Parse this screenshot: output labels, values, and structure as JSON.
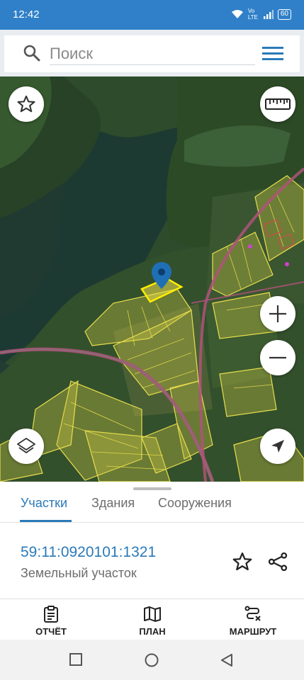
{
  "status_bar": {
    "time": "12:42",
    "network": "Vo LTE",
    "battery": "60"
  },
  "search": {
    "placeholder": "Поиск"
  },
  "map": {
    "controls": [
      "star-icon",
      "ruler-icon",
      "plus-icon",
      "minus-icon",
      "layers-icon",
      "navigation-arrow-icon"
    ],
    "marker": "map-pin-icon"
  },
  "sheet": {
    "tabs": [
      {
        "label": "Участки",
        "active": true
      },
      {
        "label": "Здания",
        "active": false
      },
      {
        "label": "Сооружения",
        "active": false
      }
    ],
    "parcel_number": "59:11:0920101:1321",
    "parcel_type": "Земельный участок"
  },
  "bottom_nav": {
    "items": [
      {
        "label": "ОТЧЁТ",
        "icon": "clipboard-icon"
      },
      {
        "label": "ПЛАН",
        "icon": "map-icon"
      },
      {
        "label": "МАРШРУТ",
        "icon": "route-icon"
      }
    ]
  },
  "colors": {
    "primary": "#2f80c8",
    "accent": "#2a7ab8",
    "parcel_outline": "#f2e24a",
    "road": "#b0527a"
  }
}
